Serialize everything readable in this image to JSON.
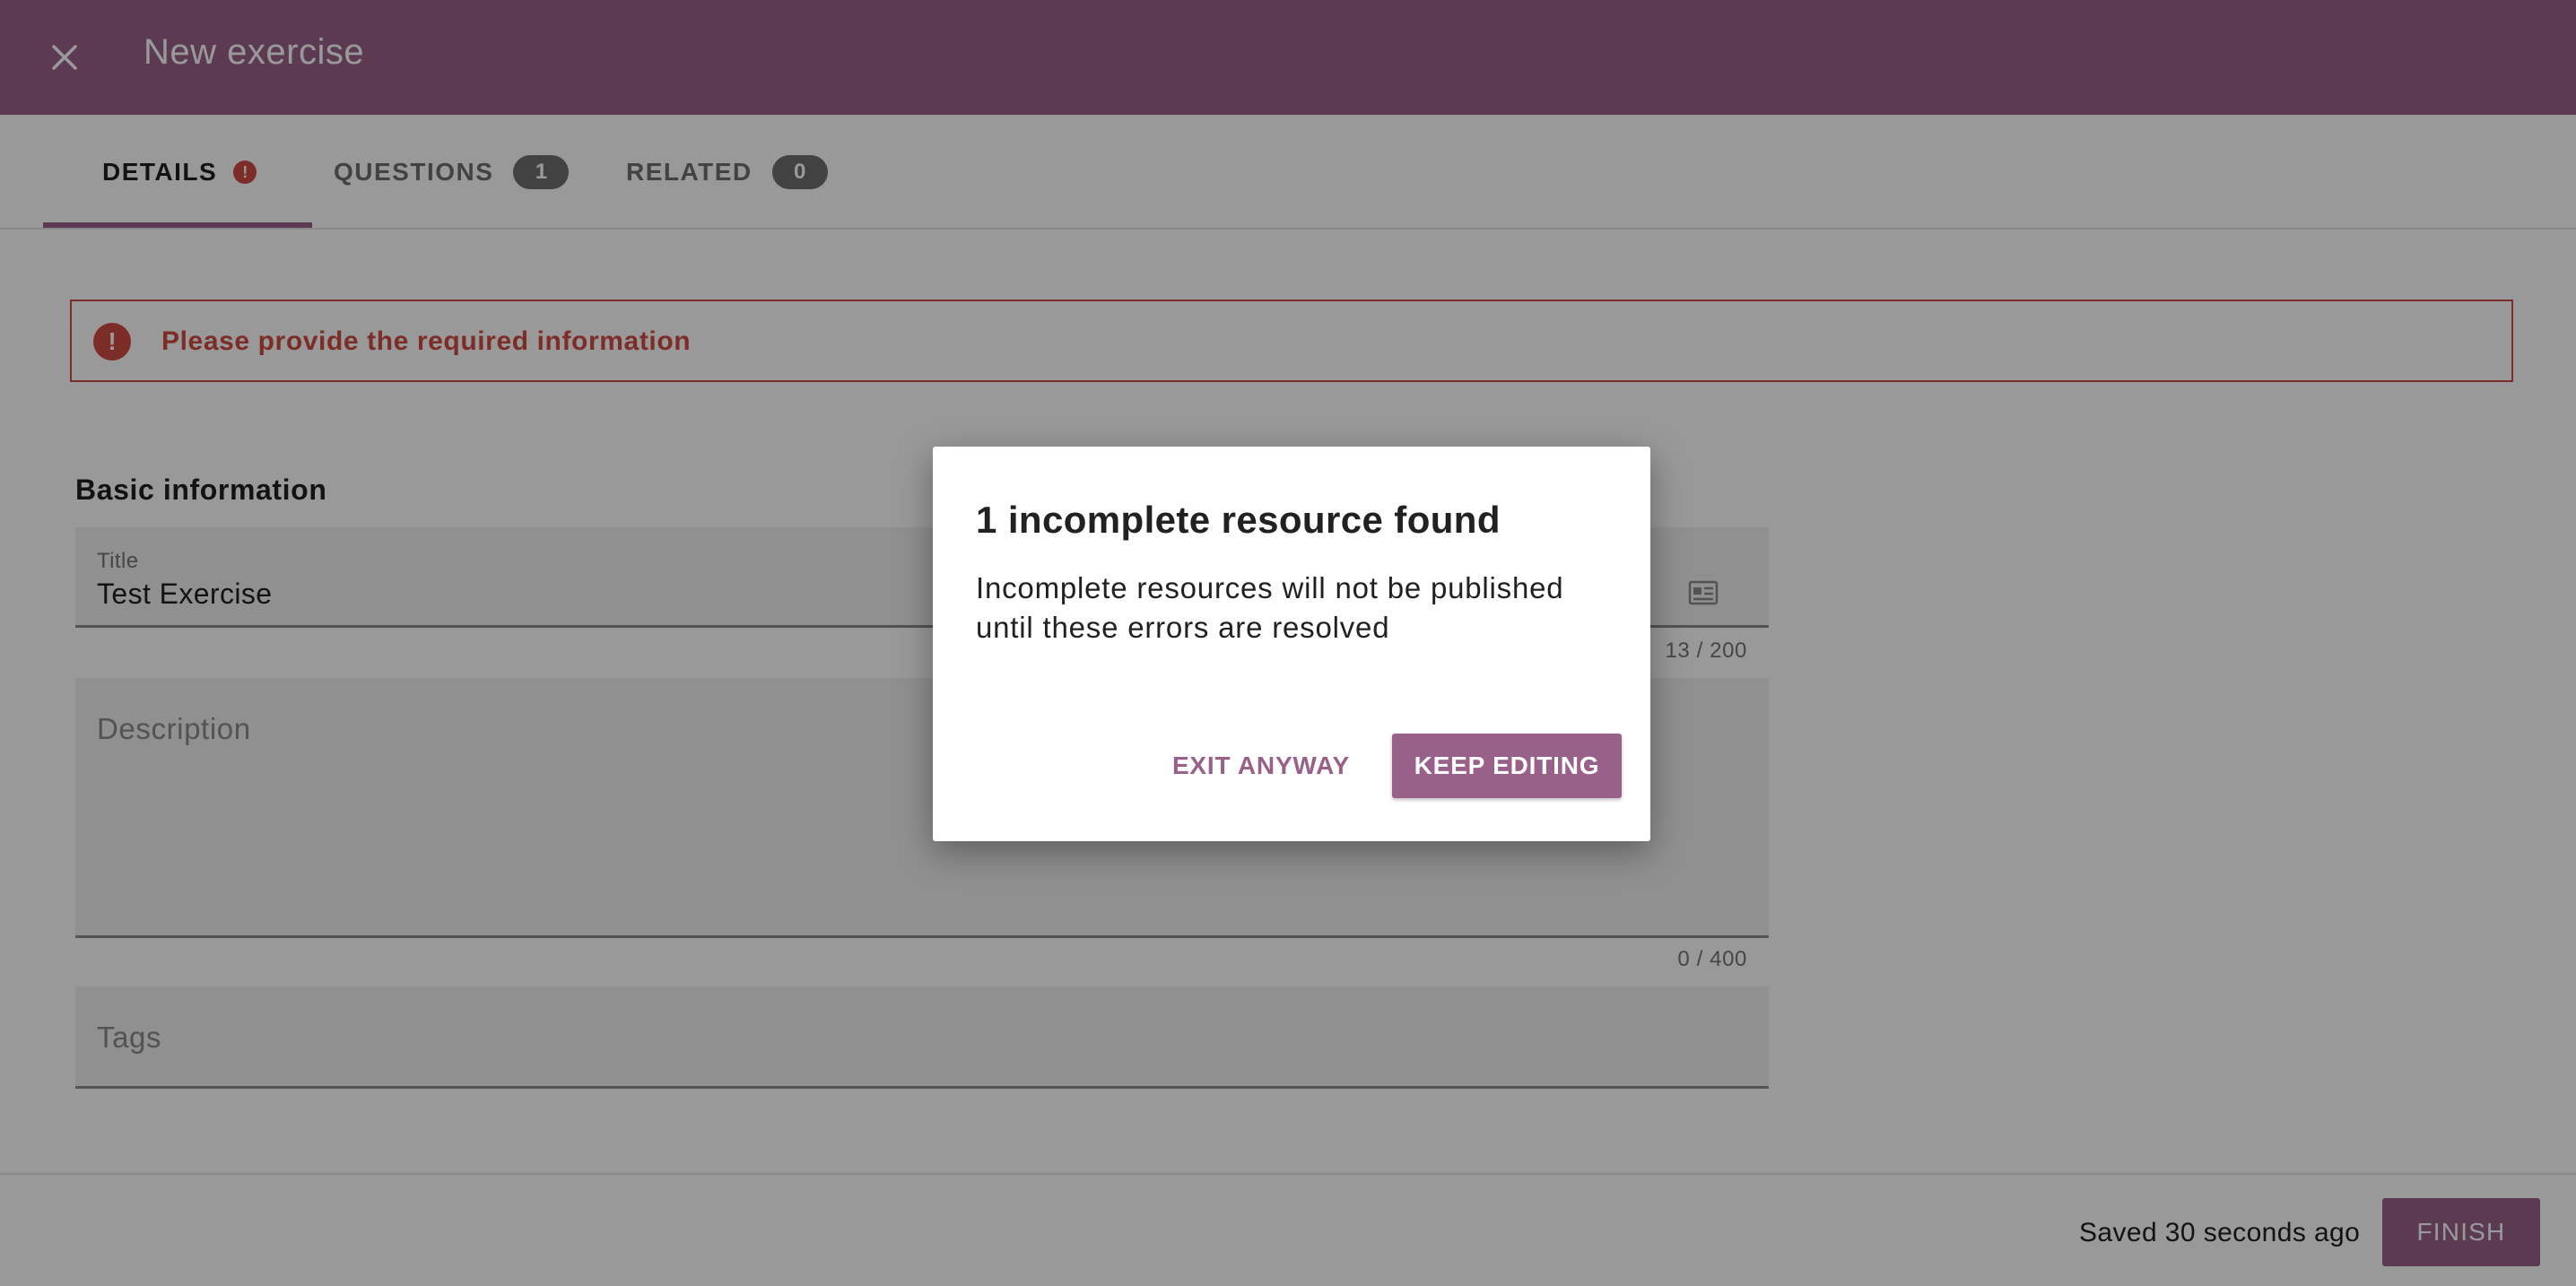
{
  "header": {
    "title": "New exercise",
    "close_icon": "close-icon"
  },
  "tabs": [
    {
      "label": "DETAILS",
      "badge": "!",
      "active": true
    },
    {
      "label": "QUESTIONS",
      "badge": "1",
      "active": false
    },
    {
      "label": "RELATED",
      "badge": "0",
      "active": false
    }
  ],
  "banner": {
    "icon": "!",
    "message": "Please provide the required information"
  },
  "form": {
    "section_heading": "Basic information",
    "title_field": {
      "label": "Title",
      "value": "Test Exercise",
      "counter": "13 / 200",
      "icon": "id-card-icon"
    },
    "description_field": {
      "placeholder": "Description",
      "counter": "0 / 400"
    },
    "tags_field": {
      "placeholder": "Tags"
    }
  },
  "footer": {
    "saved_status": "Saved 30 seconds ago",
    "finish_label": "FINISH"
  },
  "dialog": {
    "title": "1 incomplete resource found",
    "body": "Incomplete resources will not be published until these errors are resolved",
    "exit_label": "EXIT ANYWAY",
    "keep_label": "KEEP EDITING"
  },
  "colors": {
    "primary": "#996189",
    "error": "#d14b42",
    "text": "#212121",
    "muted": "#757575"
  }
}
